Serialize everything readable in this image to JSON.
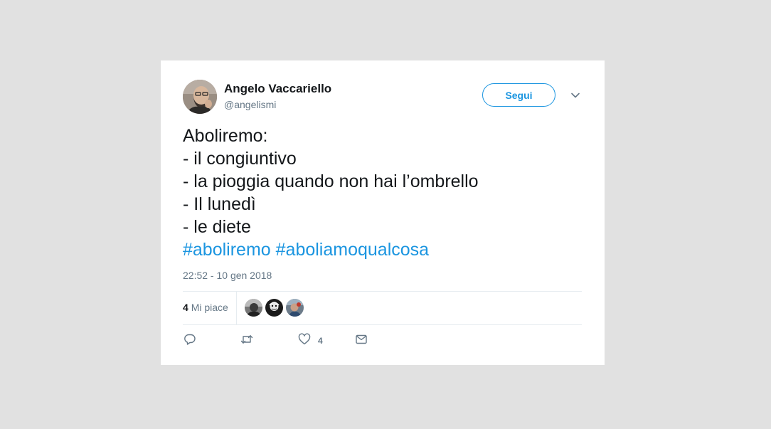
{
  "author": {
    "name": "Angelo Vaccariello",
    "handle": "@angelismi"
  },
  "follow_button": {
    "label": "Segui"
  },
  "tweet": {
    "lines": [
      "Aboliremo:",
      "- il congiuntivo",
      "- la pioggia quando non hai l’ombrello",
      "- Il lunedì",
      "- le diete"
    ],
    "hashtags": [
      "#aboliremo",
      "#aboliamoqualcosa"
    ]
  },
  "timestamp": "22:52 - 10 gen 2018",
  "stats": {
    "likes_count": "4",
    "likes_label": "Mi piace"
  },
  "actions": {
    "reply_icon": "reply-icon",
    "retweet_icon": "retweet-icon",
    "like_icon": "heart-icon",
    "like_count": "4",
    "dm_icon": "envelope-icon"
  },
  "colors": {
    "background": "#e1e1e1",
    "card": "#ffffff",
    "accent": "#1b95e0",
    "text": "#14171a",
    "secondary": "#657786"
  }
}
